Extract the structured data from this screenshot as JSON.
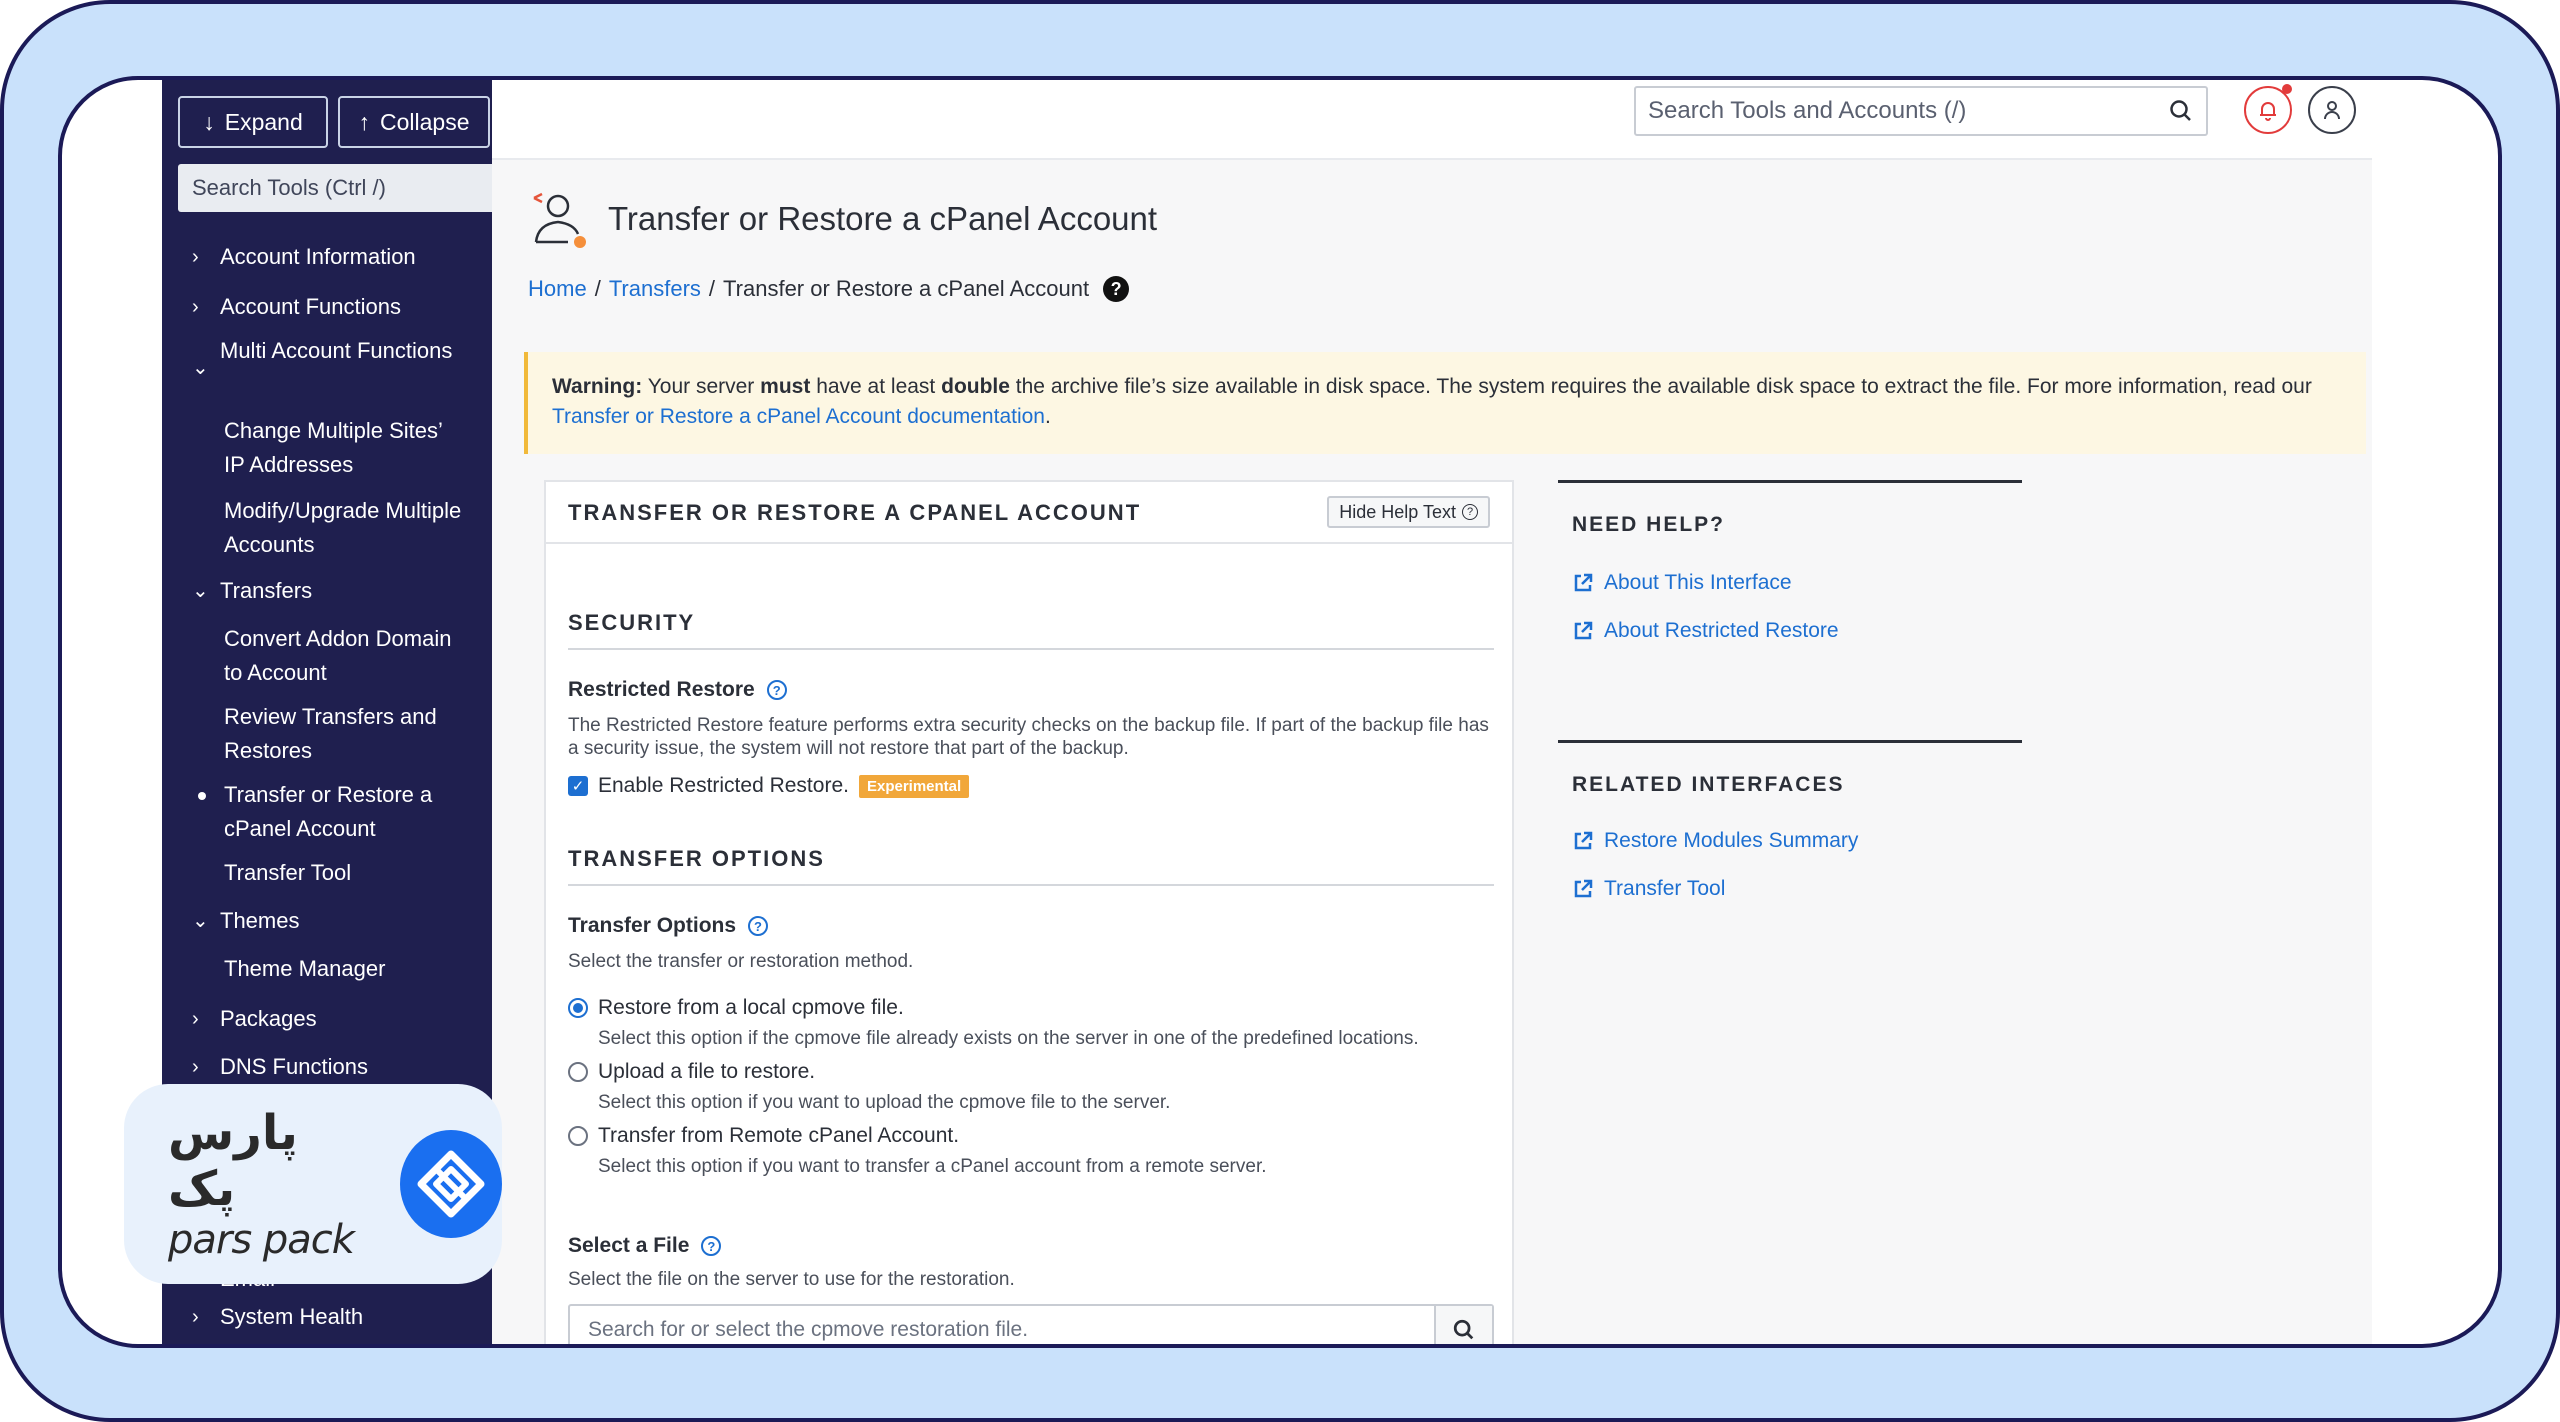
{
  "sidebar": {
    "expand_label": "Expand",
    "collapse_label": "Collapse",
    "search_placeholder": "Search Tools (Ctrl /)",
    "items": [
      {
        "label": "Account Information",
        "kind": "collapsed"
      },
      {
        "label": "Account Functions",
        "kind": "collapsed"
      },
      {
        "label": "Multi Account Functions",
        "kind": "expanded"
      },
      {
        "label": "Change Multiple Sites’ IP Addresses",
        "kind": "sub"
      },
      {
        "label": "Modify/Upgrade Multiple Accounts",
        "kind": "sub"
      },
      {
        "label": "Transfers",
        "kind": "expanded"
      },
      {
        "label": "Convert Addon Domain to Account",
        "kind": "sub"
      },
      {
        "label": "Review Transfers and Restores",
        "kind": "sub"
      },
      {
        "label": "Transfer or Restore a cPanel Account",
        "kind": "sub-active"
      },
      {
        "label": "Transfer Tool",
        "kind": "sub"
      },
      {
        "label": "Themes",
        "kind": "expanded"
      },
      {
        "label": "Theme Manager",
        "kind": "sub"
      },
      {
        "label": "Packages",
        "kind": "collapsed"
      },
      {
        "label": "DNS Functions",
        "kind": "collapsed"
      },
      {
        "label": "Email",
        "kind": "collapsed"
      },
      {
        "label": "System Health",
        "kind": "collapsed"
      }
    ]
  },
  "logo": {
    "fa": "پارس پک",
    "en": "pars pack"
  },
  "topbar": {
    "search_placeholder": "Search Tools and Accounts (/)"
  },
  "page": {
    "title": "Transfer or Restore a cPanel Account",
    "breadcrumb": {
      "home": "Home",
      "sep": "/",
      "transfers": "Transfers",
      "current": "Transfer or Restore a cPanel Account"
    }
  },
  "warning": {
    "label": "Warning:",
    "t1": "Your server",
    "must": "must",
    "t2": "have at least",
    "double": "double",
    "t3": "the archive file’s size available in disk space. The system requires the available disk space to extract the file. For more information, read our",
    "link": "Transfer or Restore a cPanel Account documentation",
    "end": "."
  },
  "card": {
    "title": "TRANSFER OR RESTORE A CPANEL ACCOUNT",
    "hide_help": "Hide Help Text",
    "security": {
      "heading": "SECURITY",
      "label": "Restricted Restore",
      "desc": "The Restricted Restore feature performs extra security checks on the backup file. If part of the backup file has a security issue, the system will not restore that part of the backup.",
      "checkbox_label": "Enable Restricted Restore.",
      "badge": "Experimental"
    },
    "options": {
      "heading": "TRANSFER OPTIONS",
      "label": "Transfer Options",
      "desc": "Select the transfer or restoration method.",
      "radios": [
        {
          "label": "Restore from a local cpmove file.",
          "desc": "Select this option if the cpmove file already exists on the server in one of the predefined locations."
        },
        {
          "label": "Upload a file to restore.",
          "desc": "Select this option if you want to upload the cpmove file to the server."
        },
        {
          "label": "Transfer from Remote cPanel Account.",
          "desc": "Select this option if you want to transfer a cPanel account from a remote server."
        }
      ]
    },
    "file": {
      "label": "Select a File",
      "desc": "Select the file on the server to use for the restoration.",
      "placeholder": "Search for or select the cpmove restoration file."
    }
  },
  "need_help": {
    "title": "NEED HELP?",
    "links": [
      "About This Interface",
      "About Restricted Restore"
    ]
  },
  "related": {
    "title": "RELATED INTERFACES",
    "links": [
      "Restore Modules Summary",
      "Transfer Tool"
    ]
  }
}
